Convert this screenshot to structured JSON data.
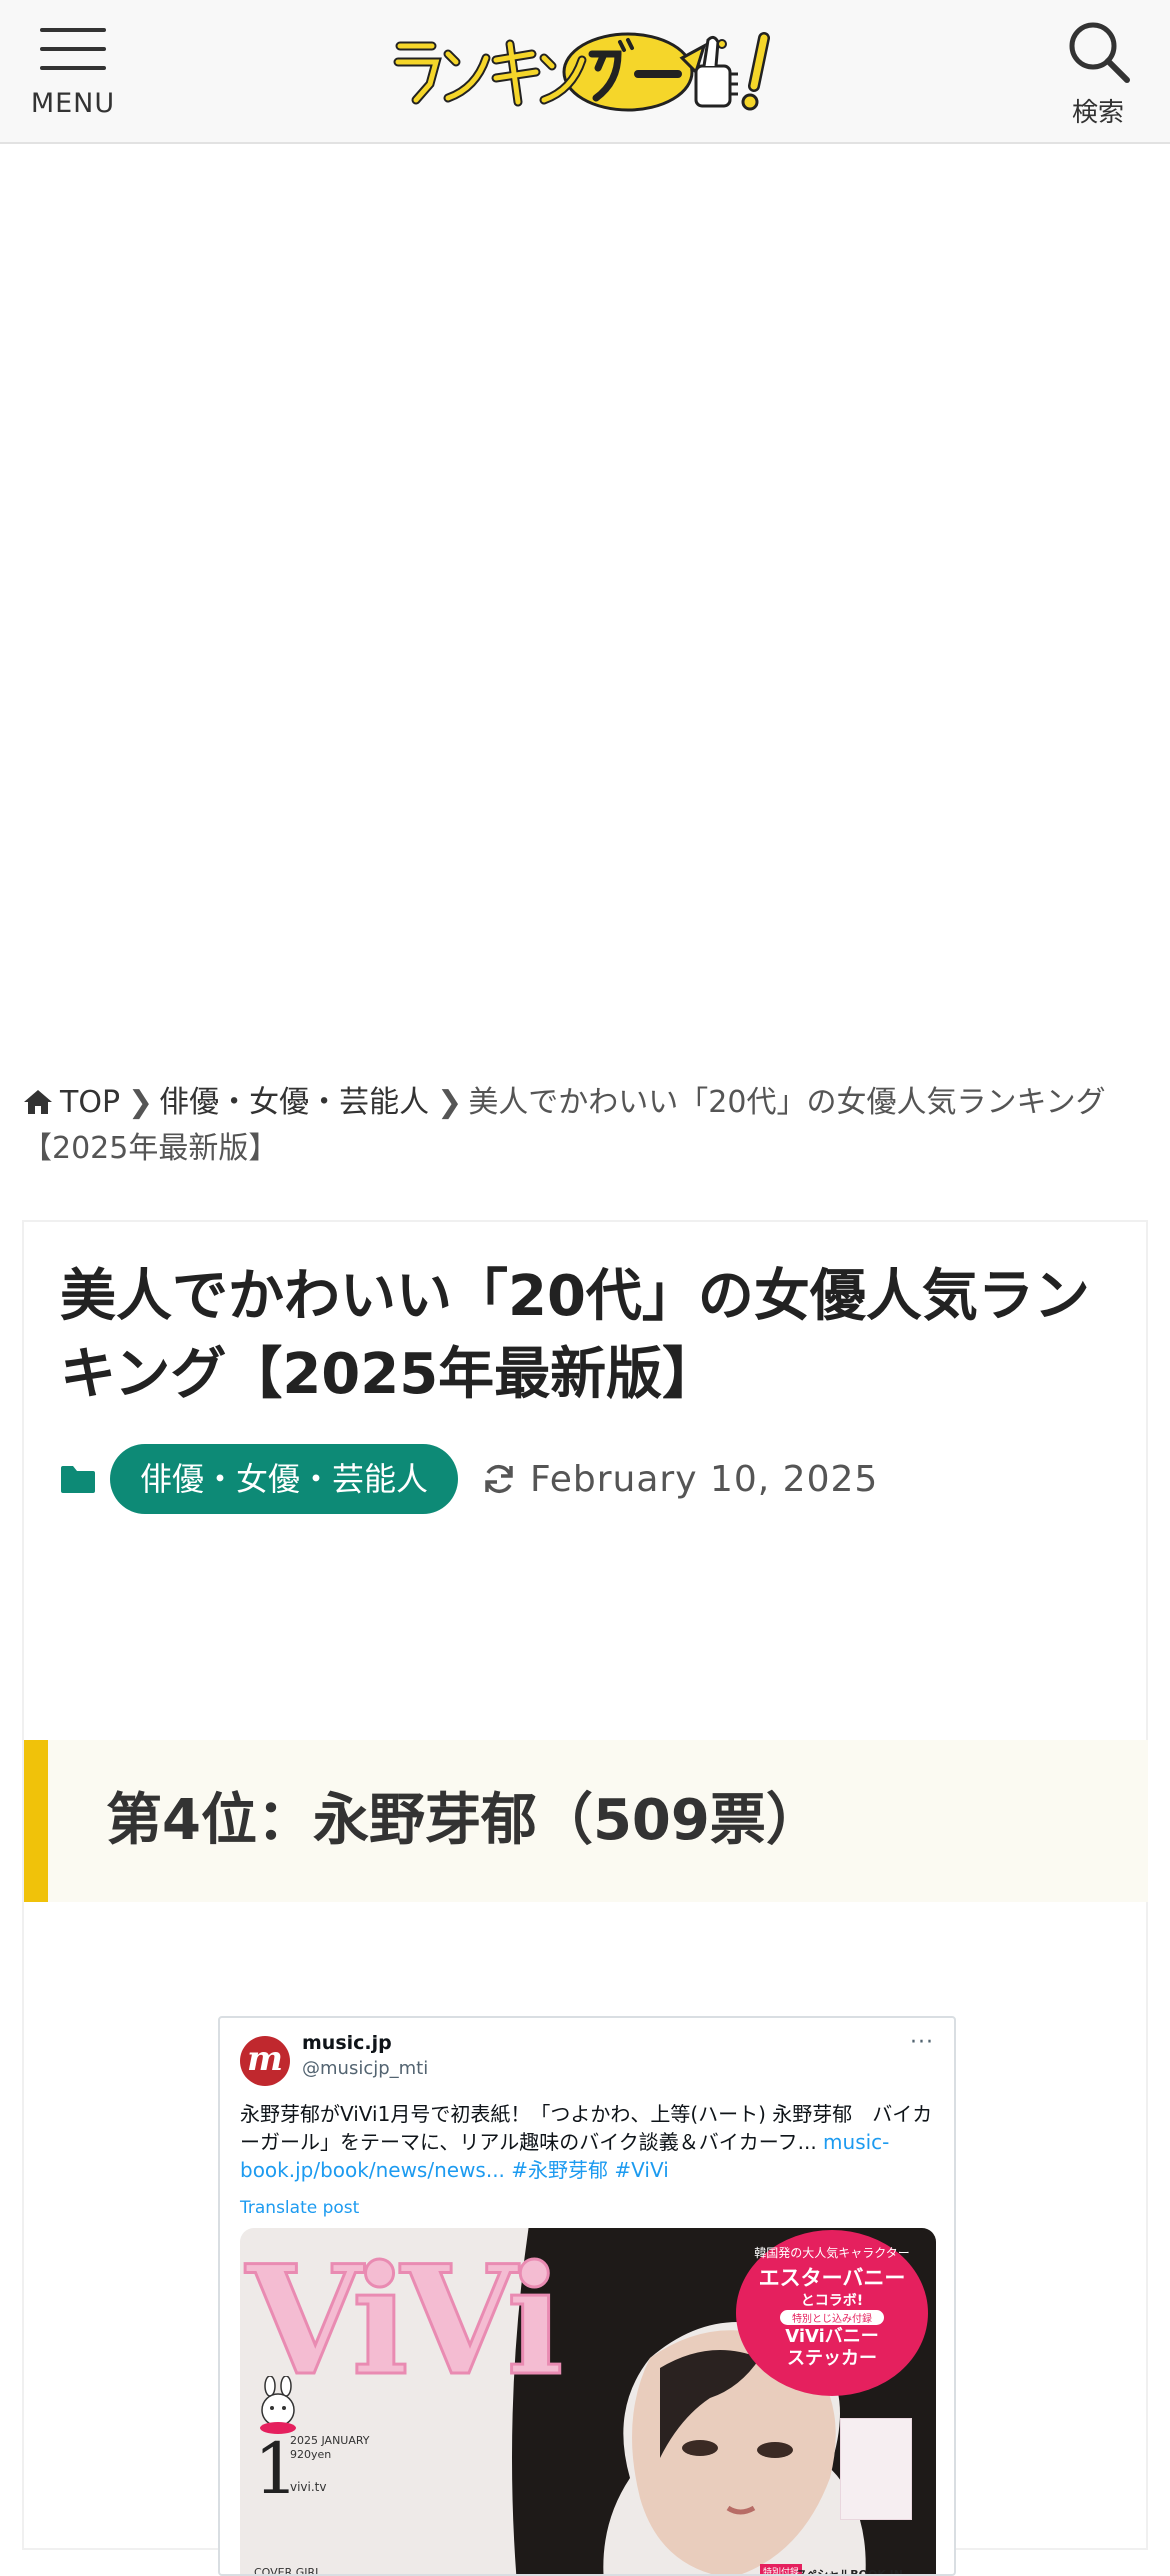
{
  "header": {
    "menu_label": "MENU",
    "search_label": "検索",
    "logo_alt": "ランキングー!"
  },
  "breadcrumb": {
    "home": "TOP",
    "category": "俳優・女優・芸能人",
    "current": "美人でかわいい「20代」の女優人気ランキング【2025年最新版】"
  },
  "article": {
    "title": "美人でかわいい「20代」の女優人気ランキング【2025年最新版】",
    "category": "俳優・女優・芸能人",
    "updated_date": "February 10, 2025",
    "rank_heading": "第4位：永野芽郁（509票）"
  },
  "tweet": {
    "name": "music.jp",
    "handle": "@musicjp_mti",
    "avatar_letter": "m",
    "more": "···",
    "text": "永野芽郁がViVi1月号で初表紙！「つよかわ、上等(ハート) 永野芽郁　バイカーガール」をテーマに、リアル趣味のバイク談義＆バイカーフ...",
    "link": "music-book.jp/book/news/news...",
    "hashtags": "#永野芽郁 #ViVi",
    "translate": "Translate post",
    "media": {
      "magazine_logo": "ViVi",
      "issue_number": "1",
      "issue_date_line1": "2025 JANUARY",
      "issue_date_line2": "920yen",
      "issue_web": "vivi.tv",
      "cover_girl": "COVER GIRL",
      "promo_line1": "韓国発の大人気キャラクター",
      "promo_line2": "エスターバニー",
      "promo_line3": "とコラボ!",
      "promo_line4": "特別とじ込み付録",
      "promo_line5": "ViViバニー",
      "promo_line6": "ステッカー",
      "special_tag": "特別付録",
      "book_label": "スペシャルBOOK IN BOOK"
    }
  },
  "colors": {
    "accent_green": "#0d8a76",
    "rank_bar_yellow": "#f0c20a",
    "logo_yellow": "#f5d62a",
    "link_blue": "#1d9bf0"
  }
}
